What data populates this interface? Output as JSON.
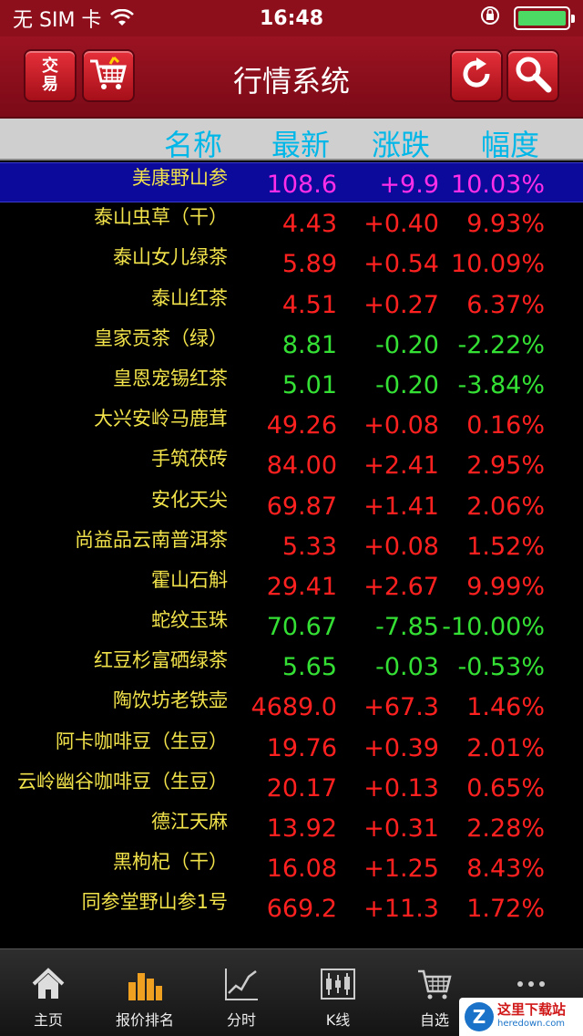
{
  "status_bar": {
    "carrier": "无 SIM 卡",
    "time": "16:48"
  },
  "nav": {
    "title": "行情系统",
    "exchange_label_top": "交",
    "exchange_label_bottom": "易"
  },
  "table": {
    "headers": [
      "名称",
      "最新",
      "涨跌",
      "幅度"
    ],
    "rows": [
      {
        "name": "美康野山参",
        "price": "108.6",
        "change": "+9.9",
        "pct": "10.03%",
        "color": "magenta",
        "selected": true
      },
      {
        "name": "泰山虫草（干）",
        "price": "4.43",
        "change": "+0.40",
        "pct": "9.93%",
        "color": "red"
      },
      {
        "name": "泰山女儿绿茶",
        "price": "5.89",
        "change": "+0.54",
        "pct": "10.09%",
        "color": "red"
      },
      {
        "name": "泰山红茶",
        "price": "4.51",
        "change": "+0.27",
        "pct": "6.37%",
        "color": "red"
      },
      {
        "name": "皇家贡茶（绿）",
        "price": "8.81",
        "change": "-0.20",
        "pct": "-2.22%",
        "color": "green"
      },
      {
        "name": "皇恩宠锡红茶",
        "price": "5.01",
        "change": "-0.20",
        "pct": "-3.84%",
        "color": "green"
      },
      {
        "name": "大兴安岭马鹿茸",
        "price": "49.26",
        "change": "+0.08",
        "pct": "0.16%",
        "color": "red"
      },
      {
        "name": "手筑茯砖",
        "price": "84.00",
        "change": "+2.41",
        "pct": "2.95%",
        "color": "red"
      },
      {
        "name": "安化天尖",
        "price": "69.87",
        "change": "+1.41",
        "pct": "2.06%",
        "color": "red"
      },
      {
        "name": "尚益品云南普洱茶",
        "price": "5.33",
        "change": "+0.08",
        "pct": "1.52%",
        "color": "red"
      },
      {
        "name": "霍山石斛",
        "price": "29.41",
        "change": "+2.67",
        "pct": "9.99%",
        "color": "red"
      },
      {
        "name": "蛇纹玉珠",
        "price": "70.67",
        "change": "-7.85",
        "pct": "-10.00%",
        "color": "green"
      },
      {
        "name": "红豆杉富硒绿茶",
        "price": "5.65",
        "change": "-0.03",
        "pct": "-0.53%",
        "color": "green"
      },
      {
        "name": "陶饮坊老铁壶",
        "price": "4689.0",
        "change": "+67.3",
        "pct": "1.46%",
        "color": "red"
      },
      {
        "name": "阿卡咖啡豆（生豆）",
        "price": "19.76",
        "change": "+0.39",
        "pct": "2.01%",
        "color": "red"
      },
      {
        "name": "云岭幽谷咖啡豆（生豆）",
        "price": "20.17",
        "change": "+0.13",
        "pct": "0.65%",
        "color": "red"
      },
      {
        "name": "德江天麻",
        "price": "13.92",
        "change": "+0.31",
        "pct": "2.28%",
        "color": "red"
      },
      {
        "name": "黑枸杞（干）",
        "price": "16.08",
        "change": "+1.25",
        "pct": "8.43%",
        "color": "red"
      },
      {
        "name": "同参堂野山参1号",
        "price": "669.2",
        "change": "+11.3",
        "pct": "1.72%",
        "color": "red"
      }
    ]
  },
  "tabs": [
    {
      "label": "主页",
      "icon": "home-icon"
    },
    {
      "label": "报价排名",
      "icon": "bar-chart-icon"
    },
    {
      "label": "分时",
      "icon": "line-chart-icon"
    },
    {
      "label": "K线",
      "icon": "candlestick-icon"
    },
    {
      "label": "自选",
      "icon": "cart-icon"
    },
    {
      "label": "",
      "icon": "more-icon"
    }
  ],
  "badge": {
    "mark": "Z",
    "main": "这里下载站",
    "sub": "heredown.com"
  },
  "colors": {
    "red": "#ff2020",
    "green": "#35e035",
    "magenta": "#ff2ee8",
    "name": "#f2e34b",
    "header": "#00b7e8",
    "nav_bg": "#8d0f1c"
  }
}
